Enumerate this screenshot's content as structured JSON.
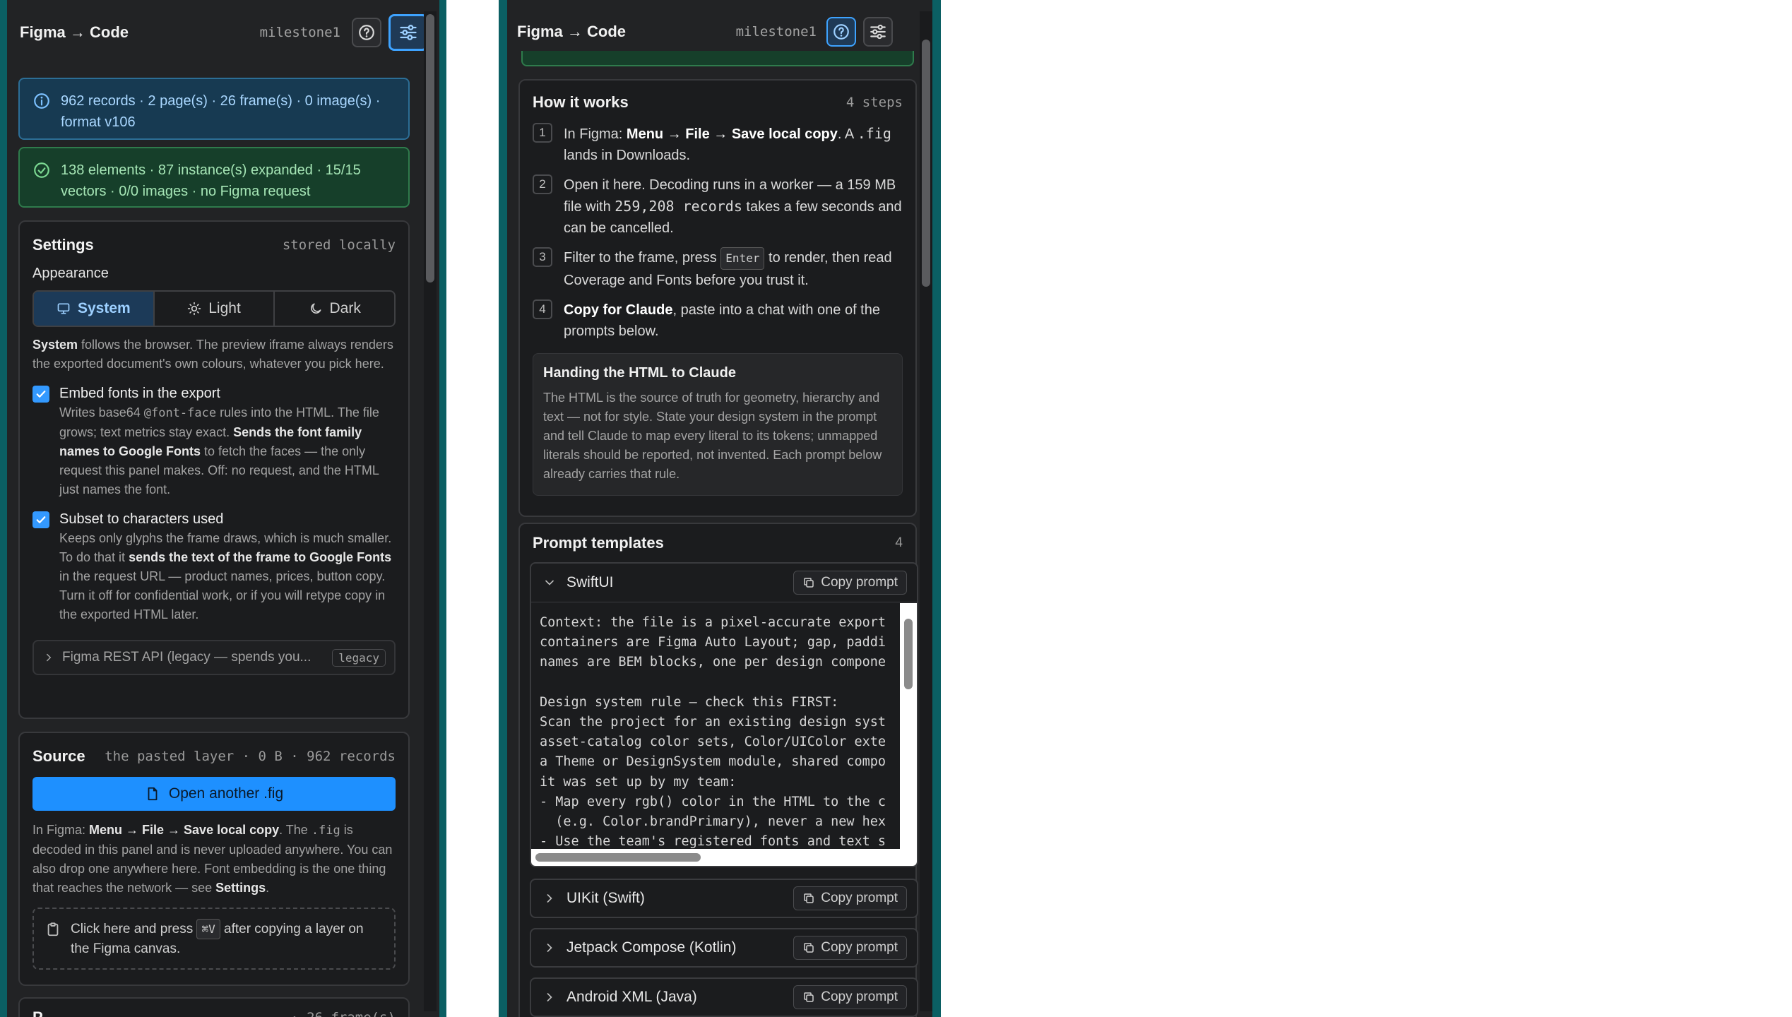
{
  "left": {
    "header": {
      "title": "Figma → Code",
      "project": "milestone1"
    },
    "banner_info": "962 records · 2 page(s) · 26 frame(s) · 0 image(s) · format v106",
    "banner_success": "138 elements · 87 instance(s) expanded · 15/15 vectors · 0/0 images · no Figma request",
    "settings": {
      "title": "Settings",
      "meta": "stored locally",
      "appearance_label": "Appearance",
      "appearance_options": [
        "System",
        "Light",
        "Dark"
      ],
      "appearance_selected": "System",
      "appearance_desc_bold": "System",
      "appearance_desc": " follows the browser. The preview iframe always renders the exported document's own colours, whatever you pick here.",
      "embed_fonts": {
        "label": "Embed fonts in the export",
        "checked": true,
        "desc_a": "Writes base64 ",
        "desc_code": "@font-face",
        "desc_b": " rules into the HTML. The file grows; text metrics stay exact. ",
        "desc_bold": "Sends the font family names to Google Fonts",
        "desc_c": " to fetch the faces — the only request this panel makes. Off: no request, and the HTML just names the font."
      },
      "subset": {
        "label": "Subset to characters used",
        "checked": true,
        "desc_a": "Keeps only glyphs the frame draws, which is much smaller. To do that it ",
        "desc_bold": "sends the text of the frame to Google Fonts",
        "desc_b": " in the request URL — product names, prices, button copy. Turn it off for confidential work, or if you will retype copy in the exported HTML later."
      },
      "rest_api": {
        "label": "Figma REST API (legacy — spends you...",
        "badge": "legacy"
      }
    },
    "source": {
      "title": "Source",
      "meta": "the pasted layer · 0 B · 962 records",
      "open_button": "Open another .fig",
      "desc_a": "In Figma: ",
      "desc_bold1": "Menu → File → Save local copy",
      "desc_b": ". The ",
      "desc_code": ".fig",
      "desc_c": " is decoded in this panel and is never uploaded anywhere. You can also drop one anywhere here. Font embedding is the one thing that reaches the network — see ",
      "desc_bold2": "Settings",
      "desc_d": ".",
      "paste_a": "Click here and press ",
      "paste_kbd": "⌘V",
      "paste_b": " after copying a layer on the Figma canvas."
    },
    "next_card_peek": {
      "title": "P",
      "meta": "· 26 frame(s)"
    }
  },
  "right": {
    "header": {
      "title": "Figma → Code",
      "project": "milestone1"
    },
    "how": {
      "title": "How it works",
      "meta": "4 steps",
      "steps": [
        {
          "n": "1",
          "a": "In Figma: ",
          "bold": "Menu → File → Save local copy",
          "b": ". A ",
          "code": ".fig",
          "c": " lands in Downloads."
        },
        {
          "n": "2",
          "a": "Open it here. Decoding runs in a worker — a 159 MB file with ",
          "code": "259,208 records",
          "b": " takes a few seconds and can be cancelled."
        },
        {
          "n": "3",
          "a": "Filter to the frame, press ",
          "kbd": "Enter",
          "b": " to render, then read Coverage and Fonts before you trust it."
        },
        {
          "n": "4",
          "bold": "Copy for Claude",
          "a": ", paste into a chat with one of the prompts below."
        }
      ],
      "handoff": {
        "title": "Handing the HTML to Claude",
        "body": "The HTML is the source of truth for geometry, hierarchy and text — not for style. State your design system in the prompt and tell Claude to map every literal to its tokens; unmapped literals should be reported, not invented. Each prompt below already carries that rule."
      }
    },
    "templates": {
      "title": "Prompt templates",
      "count": "4",
      "copy_label": "Copy prompt",
      "items": [
        {
          "name": "SwiftUI",
          "expanded": true
        },
        {
          "name": "UIKit (Swift)",
          "expanded": false
        },
        {
          "name": "Jetpack Compose (Kotlin)",
          "expanded": false
        },
        {
          "name": "Android XML (Java)",
          "expanded": false
        }
      ],
      "swiftui_prompt": [
        "Context: the file is a pixel-accurate export of a Figma frame. Flex",
        "containers are Figma Auto Layout; gap, padding and alignment are exact. Class",
        "names are BEM blocks, one per design component.",
        "",
        "Design system rule — check this FIRST:",
        "Scan the project for an existing design system before writing code:",
        "asset-catalog color sets, Color/UIColor extensions, Font extensions,",
        "a Theme or DesignSystem module, shared components. Use whatever",
        "it was set up by my team:",
        "- Map every rgb() color in the HTML to the closest token",
        "  (e.g. Color.brandPrimary), never a new hex literal.",
        "- Use the team's registered fonts and text styles."
      ]
    }
  }
}
